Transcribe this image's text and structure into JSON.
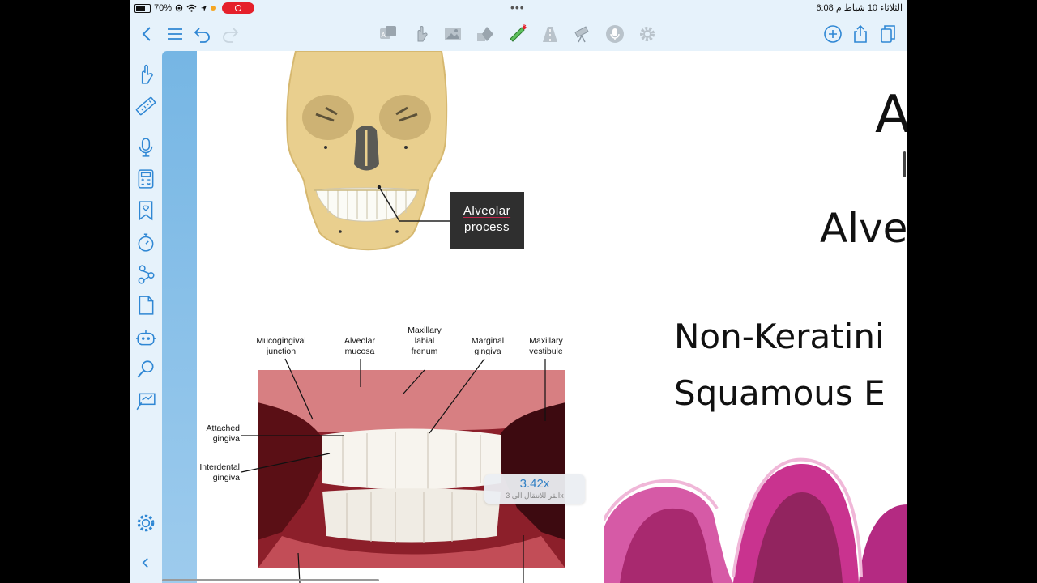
{
  "status_bar": {
    "battery_percent": "70%",
    "time": "6:08",
    "am_pm": "م",
    "date": "الثلاثاء 10 شباط",
    "multitask_dots": "•••"
  },
  "toolbar": {
    "left_icons": [
      "back-chevron-icon",
      "list-icon",
      "undo-icon",
      "redo-icon"
    ],
    "center_icons": [
      "translate-icon",
      "hand-icon",
      "image-icon",
      "shapes-icon",
      "laser-pointer-icon",
      "road-icon",
      "telescope-icon",
      "microphone-icon",
      "settings-icon"
    ],
    "right_icons": [
      "add-icon",
      "share-icon",
      "copy-icon"
    ],
    "accent": "#2f87d4"
  },
  "sidebar": {
    "icons": [
      "hand-icon",
      "ruler-icon",
      "microphone-icon",
      "calculator-icon",
      "bookmark-heart-icon",
      "timer-icon",
      "share-nodes-icon",
      "document-icon",
      "robot-icon",
      "search-icon",
      "presentation-icon",
      "settings-icon",
      "collapse-chevron-icon"
    ]
  },
  "canvas": {
    "skull_callout": {
      "line1": "Alveolar",
      "line2": "process"
    },
    "mouth_labels": {
      "mucogingival": "Mucogingival\njunction",
      "alveolar_mucosa": "Alveolar\nmucosa",
      "maxillary_labial": "Maxillary\nlabial\nfrenum",
      "marginal_gingiva": "Marginal\ngingiva",
      "maxillary_vestibule": "Maxillary\nvestibule",
      "attached_gingiva": "Attached\ngingiva",
      "interdental_gingiva": "Interdental\ngingiva"
    },
    "slide_text": {
      "title_partial": "A",
      "subtitle_partial": "Alve",
      "line1": "Non-Keratini",
      "line2": "Squamous E"
    },
    "zoom": {
      "level": "3.42x",
      "hint": "انقر للانتقال الى 3x"
    }
  },
  "colors": {
    "ui_background": "#e6f2fb",
    "icon_blue": "#2f87d4",
    "icon_gray": "#9aa5ae",
    "laser_green": "#5cc05c",
    "record_red": "#e5202b",
    "callout_bg": "#2f2f2f",
    "histology_pink": "#c9338f"
  }
}
